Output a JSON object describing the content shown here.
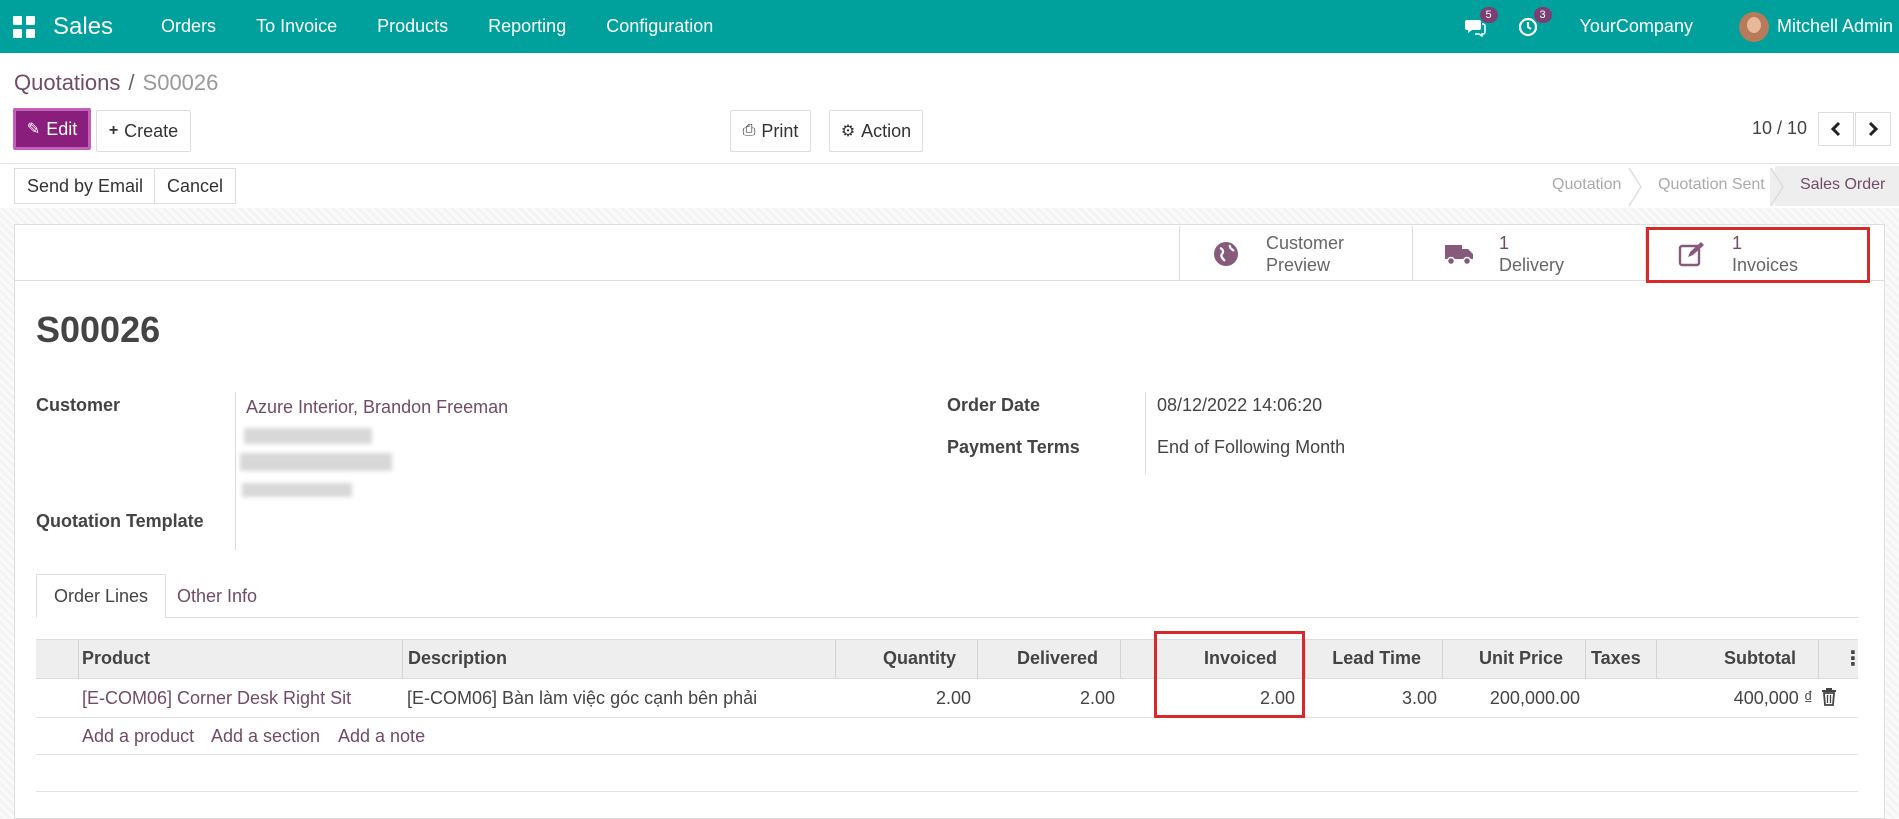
{
  "navbar": {
    "app_name": "Sales",
    "menu": [
      "Orders",
      "To Invoice",
      "Products",
      "Reporting",
      "Configuration"
    ],
    "messages_badge": "5",
    "activities_badge": "3",
    "company": "YourCompany",
    "user": "Mitchell Admin"
  },
  "breadcrumb": {
    "parent": "Quotations",
    "separator": "/",
    "current": "S00026"
  },
  "toolbar": {
    "edit": "Edit",
    "create": "Create",
    "print": "Print",
    "action": "Action",
    "pager": "10 / 10"
  },
  "header_buttons": {
    "send_email": "Send by Email",
    "cancel": "Cancel"
  },
  "statusbar": {
    "stages": [
      "Quotation",
      "Quotation Sent",
      "Sales Order"
    ],
    "active": "Sales Order"
  },
  "smart_buttons": {
    "preview": {
      "line1": "Customer",
      "line2": "Preview"
    },
    "delivery": {
      "count": "1",
      "label": "Delivery"
    },
    "invoices": {
      "count": "1",
      "label": "Invoices"
    }
  },
  "record": {
    "name": "S00026",
    "customer_label": "Customer",
    "customer_value": "Azure Interior, Brandon Freeman",
    "template_label": "Quotation Template",
    "order_date_label": "Order Date",
    "order_date_value": "08/12/2022 14:06:20",
    "payment_terms_label": "Payment Terms",
    "payment_terms_value": "End of Following Month"
  },
  "tabs": {
    "order_lines": "Order Lines",
    "other_info": "Other Info"
  },
  "table": {
    "headers": {
      "product": "Product",
      "description": "Description",
      "quantity": "Quantity",
      "delivered": "Delivered",
      "invoiced": "Invoiced",
      "lead_time": "Lead Time",
      "unit_price": "Unit Price",
      "taxes": "Taxes",
      "subtotal": "Subtotal"
    },
    "rows": [
      {
        "product": "[E-COM06] Corner Desk Right Sit",
        "description": "[E-COM06] Bàn làm việc góc cạnh bên phải",
        "quantity": "2.00",
        "delivered": "2.00",
        "invoiced": "2.00",
        "lead_time": "3.00",
        "unit_price": "200,000.00",
        "taxes": "",
        "subtotal": "400,000 ₫"
      }
    ],
    "add_product": "Add a product",
    "add_section": "Add a section",
    "add_note": "Add a note"
  },
  "colors": {
    "navbar": "#00A09D",
    "brand": "#714B67",
    "highlight": "#d62a2a"
  }
}
